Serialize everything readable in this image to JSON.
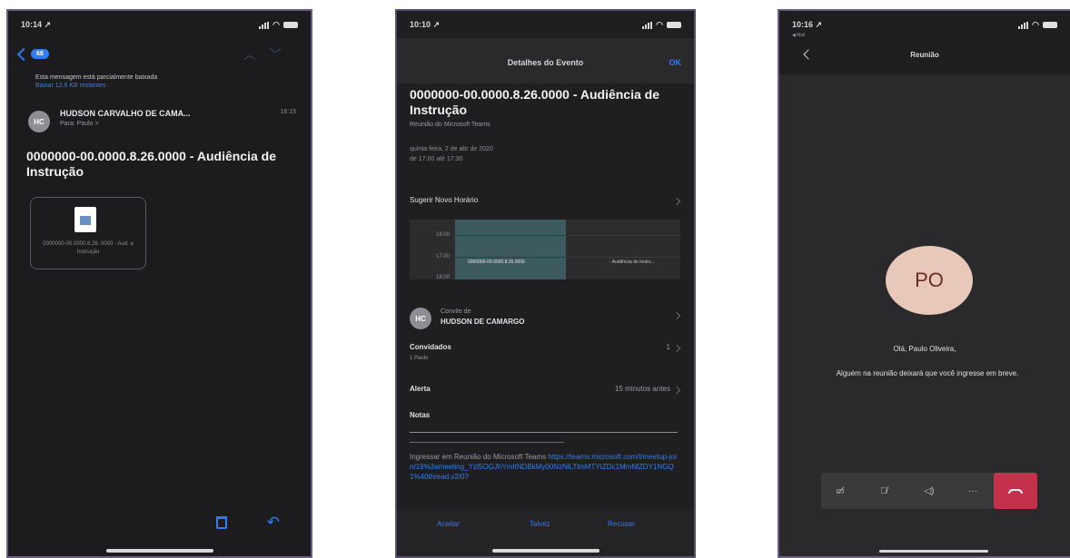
{
  "colors": {
    "accent": "#2f7cf6",
    "hangup": "#c4314b",
    "avatar_bg": "#e8c8b8"
  },
  "phone1": {
    "status_time": "10:14 ↗",
    "back_badge": "68",
    "partial_notice": "Esta mensagem está parcialmente baixada",
    "partial_link": "Baixar 12,6 KB restantes",
    "sender_initials": "HC",
    "sender": "HUDSON CARVALHO DE CAMA...",
    "to": "Para: Paulo >",
    "time": "16:15",
    "subject": "0000000-00.0000.8.26.0000 - Audiência de Instrução",
    "attachment_name": "0000000-00.0000.8.26. 0000 - Aud. a Instrução",
    "icons": [
      "chevron-left-icon",
      "chevron-up-icon",
      "chevron-down-icon",
      "document-icon",
      "trash-icon",
      "reply-icon"
    ]
  },
  "phone2": {
    "status_time": "10:10 ↗",
    "header_title": "Detalhes do Evento",
    "ok_label": "OK",
    "event_title": "0000000-00.0000.8.26.0000 - Audiência de Instrução",
    "subtitle": "Reunião do Microsoft Teams",
    "date_line1": "quinta-feira, 2 de abr de 2020",
    "date_line2": "de 17:00 até 17:30",
    "suggest_label": "Sugerir Novo Horário",
    "timeline": {
      "hours": [
        "16:00",
        "17:00",
        "18:00"
      ],
      "event_label": "0000000-00.0000.8.26.0000 - Audiência de Instru...",
      "event_label_short": "0000000-00.0000.8.26.0000"
    },
    "organizer_initials": "HC",
    "organizer_caption": "Convite de",
    "organizer_name": "HUDSON DE CAMARGO",
    "guests_label": "Convidados",
    "guests_count": "1",
    "guest_name": "1 Paulo",
    "alert_label": "Alerta",
    "alert_value": "15 minutos antes",
    "notes_label": "Notas",
    "notes_prefix": "Ingressar em Reunião do Microsoft Teams ",
    "notes_link": "https://teams.microsoft.com/l/meetup-join/19%3ameeting_YzI5OGJhYmItNDBkMy00NzNlLTlmMTYtZDc1MmNlZDY1NGQ1%40thread.v2/0?",
    "actions": [
      "Aceitar",
      "Talvez",
      "Recusar"
    ]
  },
  "phone3": {
    "status_time": "10:16 ↗",
    "carrier": "◀ Mail",
    "header_title": "Reunião",
    "avatar_initials": "PO",
    "greeting": "Olá, Paulo Oliveira,",
    "message": "Alguém na reunião deixará que você ingresse em breve.",
    "controls": [
      "camera-off-icon",
      "mic-off-icon",
      "speaker-icon",
      "more-icon",
      "hang-up-icon"
    ]
  }
}
